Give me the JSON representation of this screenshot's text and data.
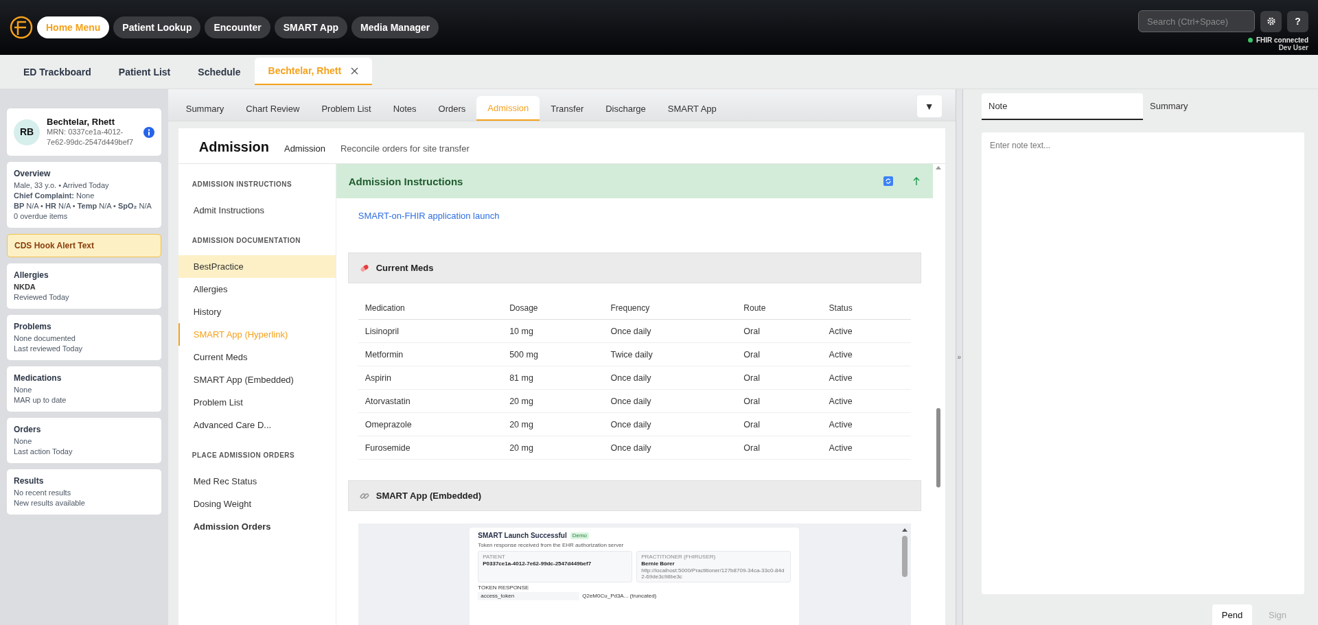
{
  "top_nav": {
    "items": [
      {
        "label": "Home Menu",
        "selected": true
      },
      {
        "label": "Patient Lookup",
        "selected": false
      },
      {
        "label": "Encounter",
        "selected": false
      },
      {
        "label": "SMART App",
        "selected": false
      },
      {
        "label": "Media Manager",
        "selected": false
      }
    ],
    "search": {
      "placeholder": "Search (Ctrl+Space)"
    },
    "help": "?",
    "status": "FHIR connected",
    "user": "Dev User"
  },
  "workspace_tabs": [
    {
      "label": "ED Trackboard",
      "selected": false,
      "closable": false
    },
    {
      "label": "Patient List",
      "selected": false,
      "closable": false
    },
    {
      "label": "Schedule",
      "selected": false,
      "closable": false
    },
    {
      "label": "Bechtelar, Rhett",
      "selected": true,
      "closable": true
    }
  ],
  "sidebar": {
    "patient": {
      "initials": "RB",
      "name": "Bechtelar, Rhett",
      "mrn": "MRN: 0337ce1a-4012-7e62-99dc-2547d449bef7"
    },
    "overview": {
      "title": "Overview",
      "lines": [
        "Male, 33 y.o. • Arrived Today",
        "**Chief Complaint:** None",
        "**BP** N/A  •  **HR** N/A  •  **Temp** N/A  •  **SpO₂** N/A",
        "0 overdue items"
      ]
    },
    "alert": "CDS Hook Alert Text",
    "cards": [
      {
        "title": "Allergies",
        "primary": "NKDA",
        "primary_bold": true,
        "secondary": "Reviewed Today"
      },
      {
        "title": "Problems",
        "primary": "None documented",
        "primary_bold": false,
        "secondary": "Last reviewed Today"
      },
      {
        "title": "Medications",
        "primary": "None",
        "primary_bold": false,
        "secondary": "MAR up to date"
      },
      {
        "title": "Orders",
        "primary": "None",
        "primary_bold": false,
        "secondary": "Last action Today"
      },
      {
        "title": "Results",
        "primary": "No recent results",
        "primary_bold": false,
        "secondary": "New results available"
      }
    ]
  },
  "activity_tabs": {
    "items": [
      {
        "label": "Summary",
        "selected": false
      },
      {
        "label": "Chart Review",
        "selected": false
      },
      {
        "label": "Problem List",
        "selected": false
      },
      {
        "label": "Notes",
        "selected": false
      },
      {
        "label": "Orders",
        "selected": false
      },
      {
        "label": "Admission",
        "selected": true
      },
      {
        "label": "Transfer",
        "selected": false
      },
      {
        "label": "Discharge",
        "selected": false
      },
      {
        "label": "SMART App",
        "selected": false
      }
    ],
    "more": "▼"
  },
  "admission": {
    "title": "Admission",
    "breadcrumb": "Admission",
    "subtitle": "Reconcile orders for site transfer",
    "nav": [
      {
        "heading": "ADMISSION INSTRUCTIONS",
        "items": [
          {
            "label": "Admit Instructions",
            "selected": false,
            "highlighted": false,
            "emphasized": false
          }
        ]
      },
      {
        "heading": "ADMISSION DOCUMENTATION",
        "items": [
          {
            "label": "BestPractice",
            "selected": false,
            "highlighted": true,
            "emphasized": false
          },
          {
            "label": "Allergies",
            "selected": false,
            "highlighted": false,
            "emphasized": false
          },
          {
            "label": "History",
            "selected": false,
            "highlighted": false,
            "emphasized": false
          },
          {
            "label": "SMART App (Hyperlink)",
            "selected": true,
            "highlighted": false,
            "emphasized": false
          },
          {
            "label": "Current Meds",
            "selected": false,
            "highlighted": false,
            "emphasized": false
          },
          {
            "label": "SMART App (Embedded)",
            "selected": false,
            "highlighted": false,
            "emphasized": false
          },
          {
            "label": "Problem List",
            "selected": false,
            "highlighted": false,
            "emphasized": false
          },
          {
            "label": "Advanced Care D...",
            "selected": false,
            "highlighted": false,
            "emphasized": false
          }
        ]
      },
      {
        "heading": "PLACE ADMISSION ORDERS",
        "items": [
          {
            "label": "Med Rec Status",
            "selected": false,
            "highlighted": false,
            "emphasized": false
          },
          {
            "label": "Dosing Weight",
            "selected": false,
            "highlighted": false,
            "emphasized": false
          },
          {
            "label": "Admission Orders",
            "selected": false,
            "highlighted": false,
            "emphasized": true
          }
        ]
      }
    ],
    "instructions": {
      "title": "Admission Instructions",
      "link": "SMART-on-FHIR application launch"
    },
    "meds": {
      "title": "Current Meds",
      "columns": [
        "Medication",
        "Dosage",
        "Frequency",
        "Route",
        "Status"
      ],
      "rows": [
        [
          "Lisinopril",
          "10 mg",
          "Once daily",
          "Oral",
          "Active"
        ],
        [
          "Metformin",
          "500 mg",
          "Twice daily",
          "Oral",
          "Active"
        ],
        [
          "Aspirin",
          "81 mg",
          "Once daily",
          "Oral",
          "Active"
        ],
        [
          "Atorvastatin",
          "20 mg",
          "Once daily",
          "Oral",
          "Active"
        ],
        [
          "Omeprazole",
          "20 mg",
          "Once daily",
          "Oral",
          "Active"
        ],
        [
          "Furosemide",
          "20 mg",
          "Once daily",
          "Oral",
          "Active"
        ]
      ]
    },
    "embedded": {
      "title": "SMART App (Embedded)",
      "app": {
        "title": "SMART Launch Successful",
        "badge": "Demo",
        "subtitle": "Token response received from the EHR authorization server",
        "patient_label": "PATIENT",
        "patient_id": "P0337ce1a-4012-7e62-99dc-2547d449bef7",
        "practitioner_label": "PRACTITIONER (FHIRUSER)",
        "practitioner_name": "Bernie Borer",
        "practitioner_url": "http://localhost:5000/Practitioner/127b8709-34ca-33c0-84d2-69de3c98be3c",
        "token_heading": "TOKEN RESPONSE",
        "token_key": "access_token",
        "token_value": "Q2eM0Cu_Pd3A... (truncated)"
      }
    }
  },
  "splitter": "»",
  "note_panel": {
    "tabs": [
      {
        "label": "Note",
        "selected": true
      },
      {
        "label": "Summary",
        "selected": false
      }
    ],
    "placeholder": "Enter note text...",
    "buttons": [
      {
        "label": "Pend",
        "disabled": false
      },
      {
        "label": "Sign",
        "disabled": true
      }
    ]
  }
}
